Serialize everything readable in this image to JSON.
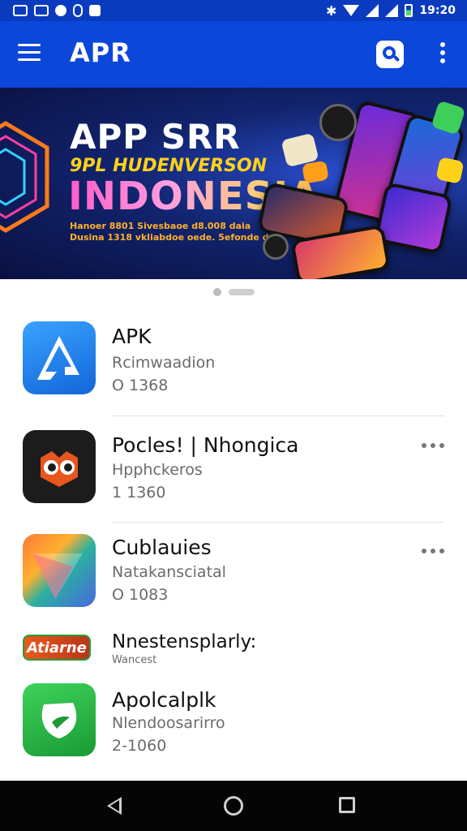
{
  "status_bar": {
    "left_icons": [
      "notification-app-icon",
      "notification-app-icon",
      "notification-app-icon",
      "notification-app-icon",
      "notification-app-icon"
    ],
    "time": "19:20"
  },
  "app_bar": {
    "title": "APR",
    "icons": [
      "menu-icon",
      "search-icon",
      "more-vert-icon"
    ]
  },
  "banner": {
    "title": "APP SRR",
    "subtitle": "9PL HUDENVERSON",
    "headline": "INDONESIA",
    "small_line_1": "Hanoer 8801 Sivesbaoe d8.008 daia",
    "small_line_2": "Dusina 1318 vkliabdoe oede. 5efonde do"
  },
  "list": [
    {
      "title": "APK",
      "subtitle": "Rcimwaadion",
      "size": "O 1368",
      "icon": "apk-icon",
      "icon_bg": "#1f7fe8",
      "has_more": false
    },
    {
      "title": "Pocles! | Nhongica",
      "subtitle": "Hpphckeros",
      "size": "1 1360",
      "icon": "owl-icon",
      "icon_bg": "#1c1c1c",
      "has_more": true
    },
    {
      "title": "Cublauies",
      "subtitle": "Natakansciatal",
      "size": "O 1083",
      "icon": "play-triangle-icon",
      "icon_bg": "#4867e0",
      "has_more": true
    },
    {
      "title": "Nnestensplarly:",
      "subtitle": "Wancest",
      "badge_text": "Atiarne",
      "icon": "badge-icon",
      "icon_bg": "#e05a1c",
      "has_more": false
    },
    {
      "title": "Apolcalplk",
      "subtitle": "Nlendoosarirro",
      "size": "2-1060",
      "icon": "leaf-icon",
      "icon_bg": "#22a83a",
      "has_more": false
    }
  ],
  "nav_bar": {
    "icons": [
      "back-icon",
      "home-icon",
      "recents-icon"
    ]
  }
}
